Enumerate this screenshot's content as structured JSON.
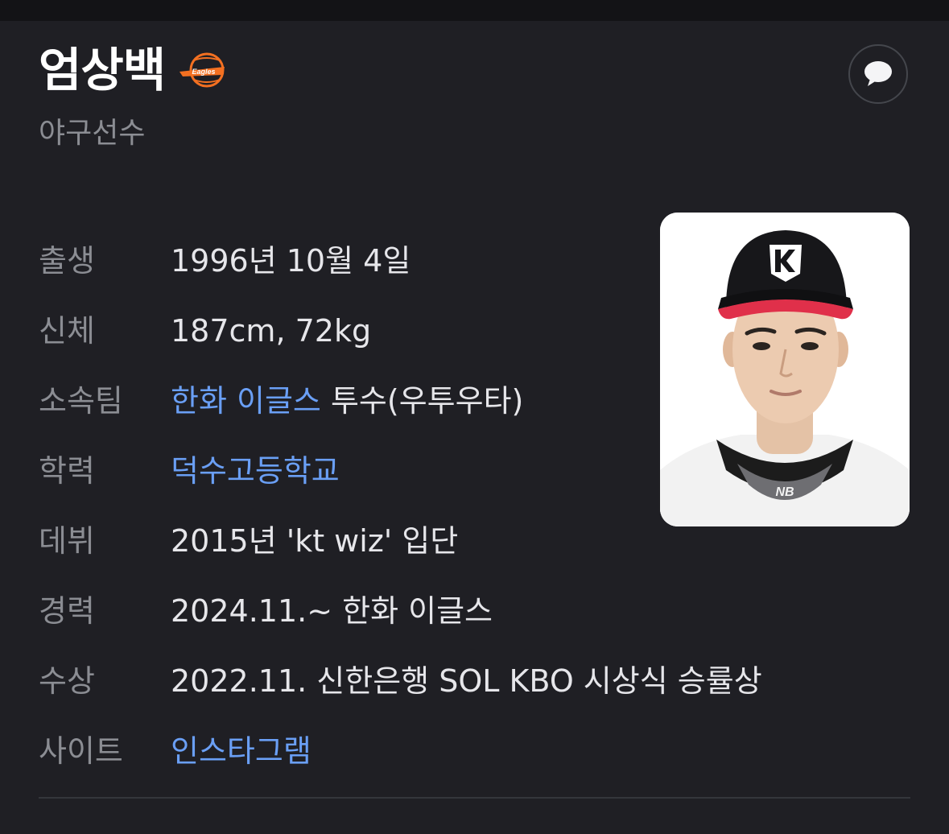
{
  "profile": {
    "name": "엄상백",
    "team_logo_text": "Eagles",
    "subtitle": "야구선수"
  },
  "info": {
    "birth": {
      "label": "출생",
      "value": "1996년 10월 4일"
    },
    "body": {
      "label": "신체",
      "value": "187cm, 72kg"
    },
    "team": {
      "label": "소속팀",
      "link": "한화 이글스",
      "rest": " 투수(우투우타)"
    },
    "education": {
      "label": "학력",
      "link": "덕수고등학교"
    },
    "debut": {
      "label": "데뷔",
      "value": "2015년 'kt wiz' 입단"
    },
    "career": {
      "label": "경력",
      "value": "2024.11.~ 한화 이글스"
    },
    "award": {
      "label": "수상",
      "value": "2022.11. 신한은행 SOL KBO 시상식 승률상"
    },
    "site": {
      "label": "사이트",
      "link": "인스타그램"
    }
  },
  "icons": {
    "comment": "speech-bubble-icon",
    "team_logo": "eagles-logo"
  },
  "colors": {
    "background": "#1f1f24",
    "link": "#6a9ff5",
    "label": "#8b8d93",
    "value": "#e6e6ea",
    "team_logo_orange": "#f37021",
    "cap_brim": "#e0304a"
  }
}
